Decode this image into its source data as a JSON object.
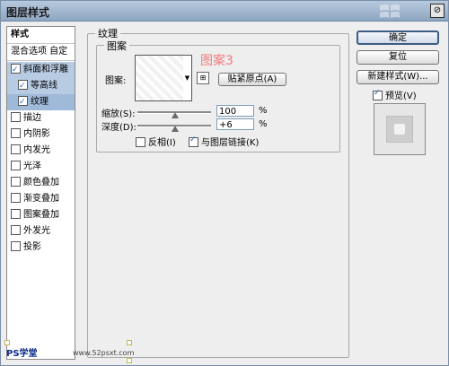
{
  "window": {
    "title": "图层样式",
    "close_glyph": "⊘"
  },
  "left_panel": {
    "header": "样式",
    "blend": "混合选项 自定",
    "items": [
      {
        "label": "斜面和浮雕",
        "checked": true
      },
      {
        "label": "等高线",
        "checked": true
      },
      {
        "label": "纹理",
        "checked": true
      },
      {
        "label": "描边",
        "checked": false
      },
      {
        "label": "内阴影",
        "checked": false
      },
      {
        "label": "内发光",
        "checked": false
      },
      {
        "label": "光泽",
        "checked": false
      },
      {
        "label": "颜色叠加",
        "checked": false
      },
      {
        "label": "渐变叠加",
        "checked": false
      },
      {
        "label": "图案叠加",
        "checked": false
      },
      {
        "label": "外发光",
        "checked": false
      },
      {
        "label": "投影",
        "checked": false
      }
    ]
  },
  "texture": {
    "group_title": "纹理",
    "pattern_group_title": "图案",
    "pattern_label": "图案:",
    "pattern_name_overlay": "图案3",
    "snap_button": "贴紧原点(A)",
    "scale_label": "缩放(S):",
    "scale_value": "100",
    "scale_unit": "%",
    "depth_label": "深度(D):",
    "depth_value": "+6",
    "depth_unit": "%",
    "invert_label": "反相(I)",
    "invert_checked": false,
    "link_label": "与图层链接(K)",
    "link_checked": true
  },
  "right": {
    "ok": "确定",
    "reset": "复位",
    "new_style": "新建样式(W)...",
    "preview_label": "预览(V)",
    "preview_checked": true
  },
  "watermark": {
    "text": "PS学堂",
    "site": "www.52psxt.com"
  }
}
